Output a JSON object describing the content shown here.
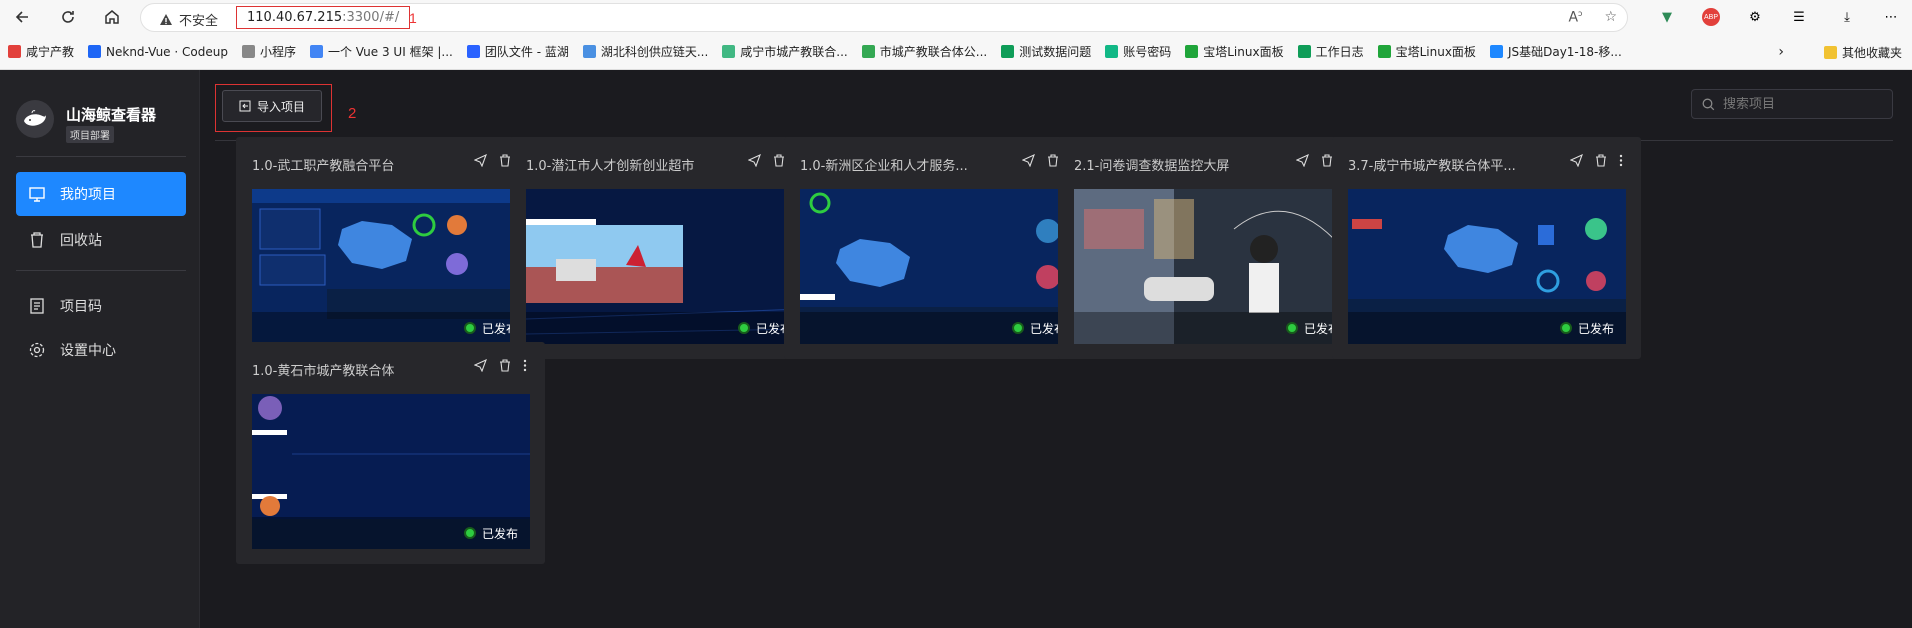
{
  "browser": {
    "insecure_label": "不安全",
    "url_host": "110.40.67.215",
    "url_path": ":3300/#/",
    "annotation_1": "1",
    "bookmarks": [
      {
        "label": "咸宁产教",
        "color": "#e2403b"
      },
      {
        "label": "Neknd-Vue · Codeup",
        "color": "#1e66f5"
      },
      {
        "label": "小程序",
        "color": "#888888"
      },
      {
        "label": "一个 Vue 3 UI 框架 |...",
        "color": "#4285f4"
      },
      {
        "label": "团队文件 - 蓝湖",
        "color": "#2a62ff"
      },
      {
        "label": "湖北科创供应链天...",
        "color": "#4a90e2"
      },
      {
        "label": "咸宁市城产教联合...",
        "color": "#41b883"
      },
      {
        "label": "市城产教联合体公...",
        "color": "#34a853"
      },
      {
        "label": "测试数据问题",
        "color": "#0f9d58"
      },
      {
        "label": "账号密码",
        "color": "#12b886"
      },
      {
        "label": "宝塔Linux面板",
        "color": "#20a53a"
      },
      {
        "label": "工作日志",
        "color": "#0f9d58"
      },
      {
        "label": "宝塔Linux面板",
        "color": "#20a53a"
      },
      {
        "label": "JS基础Day1-18-移...",
        "color": "#1e88ff"
      }
    ],
    "other_bookmarks": "其他收藏夹"
  },
  "sidebar": {
    "brand": "山海鲸查看器",
    "brand_sub": "项目部署",
    "items": [
      {
        "label": "我的项目",
        "active": true
      },
      {
        "label": "回收站",
        "active": false
      },
      {
        "label": "项目码",
        "active": false
      },
      {
        "label": "设置中心",
        "active": false
      }
    ]
  },
  "main": {
    "import_label": "导入项目",
    "annotation_2": "2",
    "search_placeholder": "搜索项目",
    "status_label": "已发布",
    "projects": [
      {
        "title": "1.0-武工职产教融合平台",
        "status": "已发布"
      },
      {
        "title": "1.0-潜江市人才创新创业超市",
        "status": "已发布"
      },
      {
        "title": "1.0-新洲区企业和人才服务...",
        "status": "已发布"
      },
      {
        "title": "2.1-问卷调查数据监控大屏",
        "status": "已发布"
      },
      {
        "title": "3.7-咸宁市城产教联合体平...",
        "status": "已发布"
      },
      {
        "title": "1.0-黄石市城产教联合体",
        "status": "已发布"
      }
    ]
  },
  "colors": {
    "accent": "#1e88ff",
    "published": "#2ecc40",
    "annotation": "#dd3333"
  }
}
